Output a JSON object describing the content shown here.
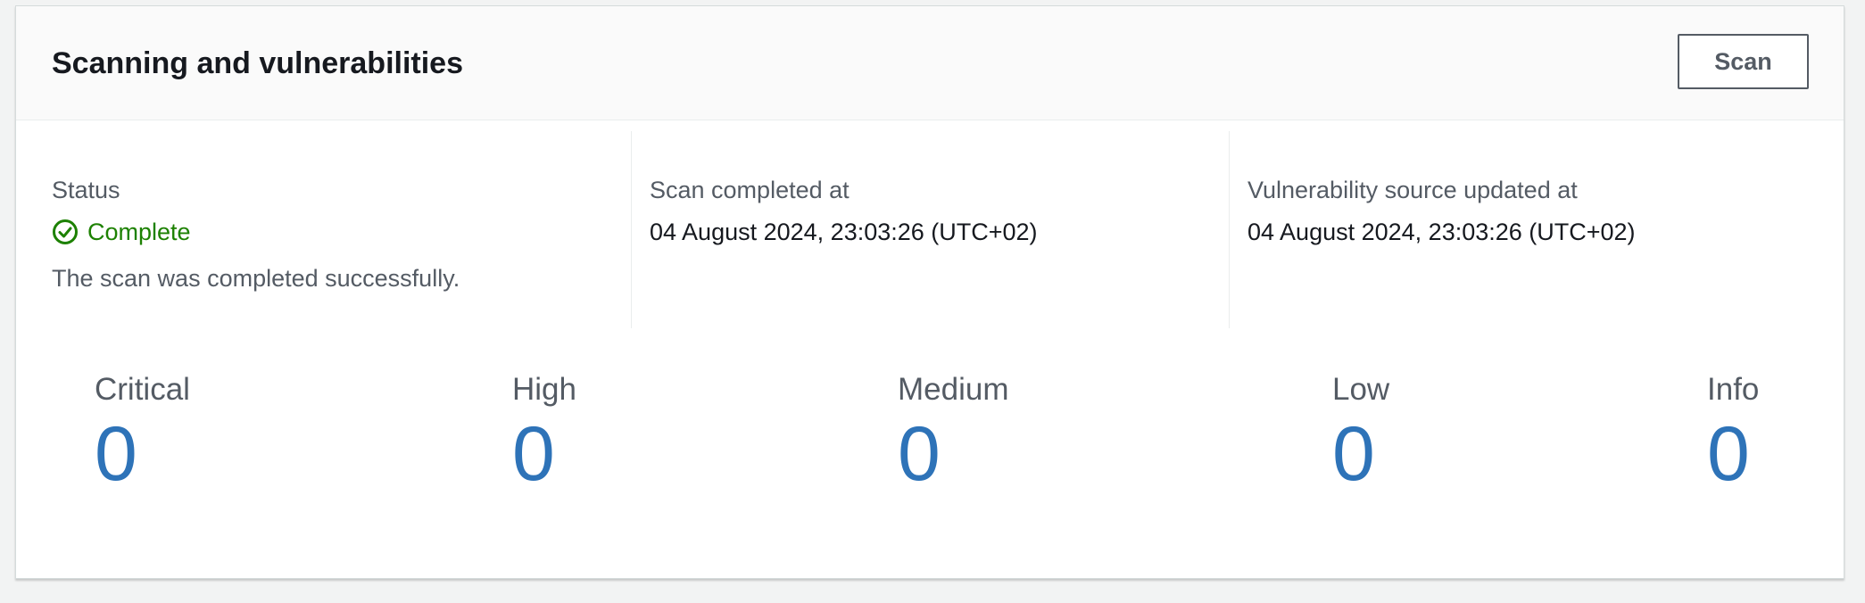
{
  "panel": {
    "title": "Scanning and vulnerabilities",
    "scan_button_label": "Scan"
  },
  "status": {
    "label": "Status",
    "value": "Complete",
    "description": "The scan was completed successfully.",
    "icon": "check-circle-icon",
    "color": "#1d8102"
  },
  "scan_completed": {
    "label": "Scan completed at",
    "value": "04 August 2024, 23:03:26 (UTC+02)"
  },
  "vuln_source": {
    "label": "Vulnerability source updated at",
    "value": "04 August 2024, 23:03:26 (UTC+02)"
  },
  "severity": [
    {
      "label": "Critical",
      "count": "0"
    },
    {
      "label": "High",
      "count": "0"
    },
    {
      "label": "Medium",
      "count": "0"
    },
    {
      "label": "Low",
      "count": "0"
    },
    {
      "label": "Info",
      "count": "0"
    }
  ],
  "colors": {
    "accent": "#2e73b8",
    "success": "#1d8102",
    "text_primary": "#16191f",
    "text_secondary": "#545b64"
  }
}
